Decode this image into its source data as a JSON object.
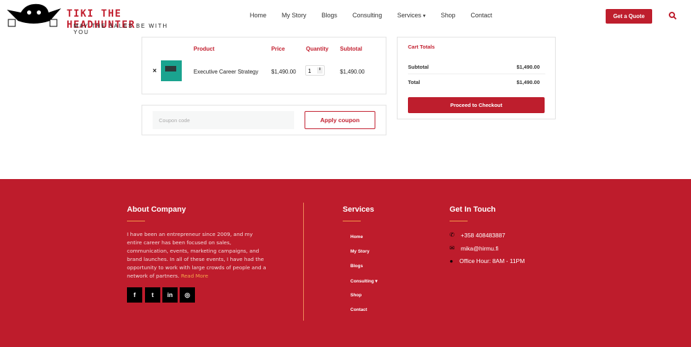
{
  "header": {
    "brand": "TIKI THE HEADHUNTER",
    "tagline": "MAY THE SALES BE WITH YOU",
    "nav": [
      "Home",
      "My Story",
      "Blogs",
      "Consulting",
      "Services",
      "Shop",
      "Contact"
    ],
    "quote": "Get a Quote"
  },
  "cart": {
    "headers": {
      "product": "Product",
      "price": "Price",
      "quantity": "Quantity",
      "subtotal": "Subtotal"
    },
    "items": [
      {
        "name": "Executive Career Strategy",
        "price": "$1,490.00",
        "qty": "1",
        "subtotal": "$1,490.00"
      }
    ],
    "coupon_placeholder": "Coupon code",
    "apply": "Apply coupon"
  },
  "totals": {
    "title": "Cart Totals",
    "subtotal_label": "Subtotal",
    "subtotal": "$1,490.00",
    "total_label": "Total",
    "total": "$1,490.00",
    "checkout": "Proceed to Checkout"
  },
  "footer": {
    "about_title": "About Company",
    "about_text": "I have been an entrepreneur since 2009, and my entire career has been focused on sales, communication, events, marketing campaigns, and brand launches. In all of these events, I have had the opportunity to work with large crowds of people and a network of partners.",
    "read_more": "Read More",
    "services_title": "Services",
    "services": [
      "Home",
      "My Story",
      "Blogs",
      "Consulting",
      "Shop",
      "Contact"
    ],
    "contact_title": "Get In Touch",
    "phone": "+358 408483887",
    "email": "mika@hirmu.fi",
    "hours": "Office Hour: 8AM - 11PM"
  }
}
